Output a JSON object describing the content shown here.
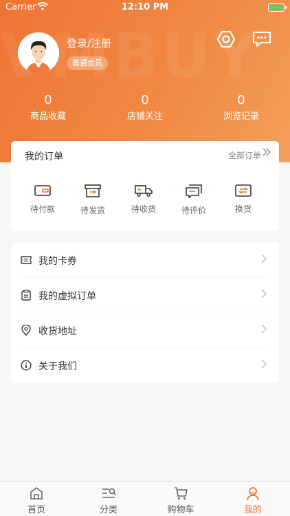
{
  "status_bar": {
    "carrier": "Carrier",
    "time": "12:10 PM"
  },
  "watermark": "VMBUY",
  "profile": {
    "login_label": "登录/注册",
    "member_level": "普通会员"
  },
  "header_icons": [
    "settings-icon",
    "message-icon"
  ],
  "stats": [
    {
      "value": "0",
      "label": "商品收藏"
    },
    {
      "value": "0",
      "label": "店铺关注"
    },
    {
      "value": "0",
      "label": "浏览记录"
    }
  ],
  "orders": {
    "title": "我的订单",
    "all_label": "全部订单",
    "items": [
      {
        "label": "待付款",
        "icon": "wallet-icon"
      },
      {
        "label": "待发货",
        "icon": "box-icon"
      },
      {
        "label": "待收货",
        "icon": "truck-icon"
      },
      {
        "label": "待评价",
        "icon": "comment-icon"
      },
      {
        "label": "换货",
        "icon": "exchange-icon"
      }
    ]
  },
  "menu": [
    {
      "label": "我的卡券",
      "icon": "ticket-icon"
    },
    {
      "label": "我的虚拟订单",
      "icon": "clipboard-icon"
    },
    {
      "label": "收货地址",
      "icon": "location-pin-icon"
    },
    {
      "label": "关于我们",
      "icon": "info-icon"
    }
  ],
  "tabbar": {
    "items": [
      {
        "label": "首页",
        "icon": "home-icon"
      },
      {
        "label": "分类",
        "icon": "category-search-icon"
      },
      {
        "label": "购物车",
        "icon": "cart-icon"
      },
      {
        "label": "我的",
        "icon": "user-icon"
      }
    ],
    "active_index": 3
  },
  "colors": {
    "accent": "#ee7434",
    "background": "#f6f6f6"
  }
}
